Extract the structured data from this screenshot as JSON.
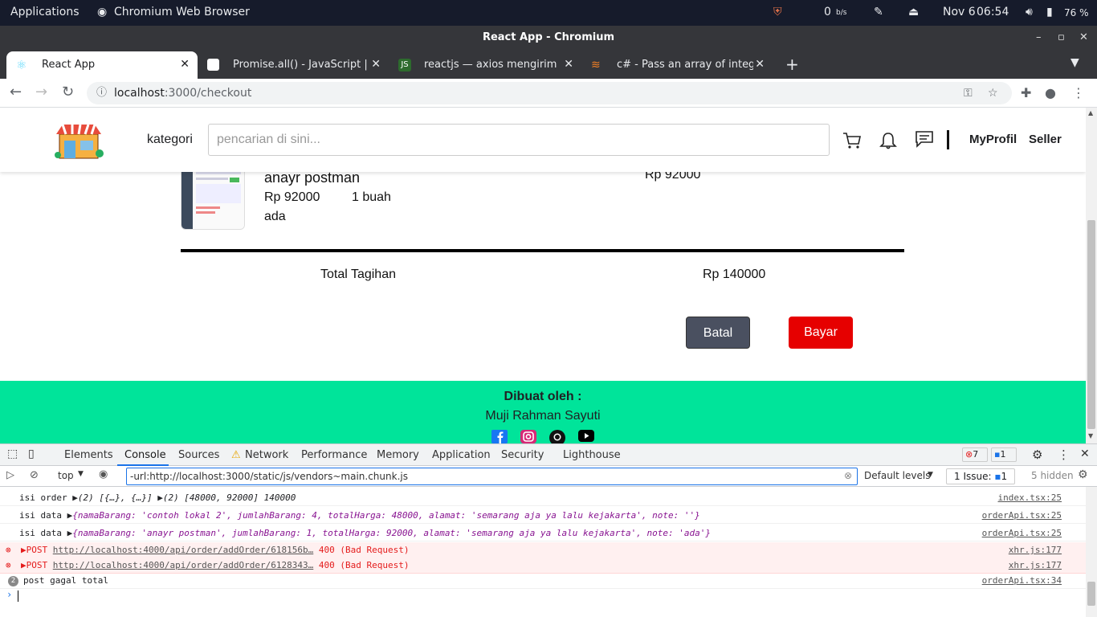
{
  "os": {
    "applications": "Applications",
    "browser_name": "Chromium Web Browser",
    "net_speed": "0",
    "net_unit": "b/s",
    "date": "Nov 6",
    "time": "06:54",
    "battery": "76 %"
  },
  "window": {
    "title": "React App - Chromium"
  },
  "tabs": [
    {
      "label": "React App"
    },
    {
      "label": "Promise.all() - JavaScript | MDN"
    },
    {
      "label": "reactjs — axios mengirim permintaan"
    },
    {
      "label": "c# - Pass an array of integers to"
    }
  ],
  "address": {
    "host": "localhost",
    "path": ":3000/checkout"
  },
  "header": {
    "kategori": "kategori",
    "search_placeholder": "pencarian di sini...",
    "myprofil": "MyProfil",
    "seller": "Seller"
  },
  "item": {
    "name": "anayr postman",
    "price": "Rp 92000",
    "qty": "1 buah",
    "note": "ada",
    "subtotal": "Rp 92000"
  },
  "total": {
    "label": "Total Tagihan",
    "value": "Rp 140000"
  },
  "buttons": {
    "batal": "Batal",
    "bayar": "Bayar"
  },
  "footer": {
    "title": "Dibuat oleh :",
    "author": "Muji Rahman Sayuti"
  },
  "devtools": {
    "tabs": [
      "Elements",
      "Console",
      "Sources",
      "Network",
      "Performance",
      "Memory",
      "Application",
      "Security",
      "Lighthouse"
    ],
    "error_count": "7",
    "message_count": "1",
    "context": "top",
    "filter": "-url:http://localhost:3000/static/js/vendors~main.chunk.js",
    "levels": "Default levels",
    "issues": "1 Issue:",
    "issues_count": "1",
    "hidden": "5 hidden"
  },
  "console": {
    "rows": [
      {
        "prefix": "isi order",
        "body": "(2) [{…}, {…}]  ▶(2) [48000, 92000] 140000",
        "src": "index.tsx:25"
      },
      {
        "prefix": "isi data",
        "body": "{namaBarang: 'contoh lokal 2', jumlahBarang: 4, totalHarga: 48000, alamat: 'semarang aja ya lalu kejakarta', note: ''}",
        "src": "orderApi.tsx:25"
      },
      {
        "prefix": "isi data",
        "body": "{namaBarang: 'anayr postman', jumlahBarang: 1, totalHarga: 92000, alamat: 'semarang aja ya lalu kejakarta', note: 'ada'}",
        "src": "orderApi.tsx:25"
      },
      {
        "method": "POST",
        "url": "http://localhost:4000/api/order/addOrder/618156b…",
        "status": "400 (Bad Request)",
        "src": "xhr.js:177"
      },
      {
        "method": "POST",
        "url": "http://localhost:4000/api/order/addOrder/6128343…",
        "status": "400 (Bad Request)",
        "src": "xhr.js:177"
      },
      {
        "count": "2",
        "body": "post gagal total",
        "src": "orderApi.tsx:34"
      }
    ]
  },
  "colors": {
    "footer": "#00e49a",
    "bayar": "#e60000",
    "batal": "#4a5060",
    "devtools_accent": "#1a73e8"
  }
}
